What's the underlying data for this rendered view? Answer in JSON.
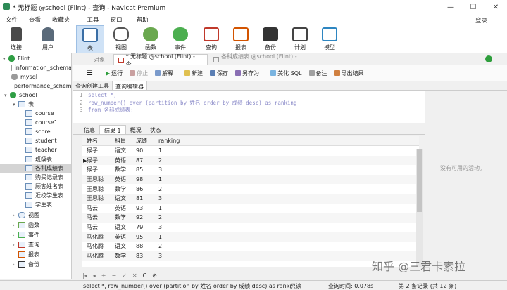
{
  "window": {
    "title": "* 无标题 @school (Flint) - 查询 - Navicat Premium",
    "min": "—",
    "max": "☐",
    "close": "✕"
  },
  "menu": [
    "文件",
    "查看",
    "收藏夹",
    "工具",
    "窗口",
    "帮助"
  ],
  "login_label": "登录",
  "toolbar": {
    "connect": "连接",
    "user": "用户",
    "table": "表",
    "view": "视图",
    "function": "函数",
    "event": "事件",
    "query": "查询",
    "report": "报表",
    "backup": "备份",
    "schedule": "计划",
    "model": "模型"
  },
  "sidebar": {
    "items": [
      "Flint",
      "information_schema",
      "mysql",
      "performance_schema",
      "school",
      "表",
      "course",
      "course1",
      "score",
      "student",
      "teacher",
      "班级表",
      "各科成绩表",
      "购买记录表",
      "顾客姓名表",
      "近校学生表",
      "学生表",
      "视图",
      "函数",
      "事件",
      "查询",
      "报表",
      "备份"
    ]
  },
  "tabs": {
    "objects": "对象",
    "active": "* 无标题 @school (Flint) - 查...",
    "inactive": "各科成绩表 @school (Flint) - ..."
  },
  "query_toolbar": {
    "run": "运行",
    "stop": "停止",
    "explain": "解释",
    "new": "新建",
    "save": "保存",
    "save_as": "另存为",
    "beautify": "美化 SQL",
    "comment": "备注",
    "export": "导出结果"
  },
  "query_tabs": [
    "查询创建工具",
    "查询编辑器"
  ],
  "editor": {
    "line1": "select *,",
    "line2": "row_number() over (partition by 姓名 order by 成绩 desc) as ranking",
    "line3": "from 各科成绩表;"
  },
  "result_tabs": [
    "信息",
    "结果 1",
    "概况",
    "状态"
  ],
  "grid": {
    "columns": [
      "姓名",
      "科目",
      "成绩",
      "ranking"
    ],
    "rows": [
      [
        "猴子",
        "语文",
        "90",
        "1"
      ],
      [
        "猴子",
        "英语",
        "87",
        "2"
      ],
      [
        "猴子",
        "数学",
        "85",
        "3"
      ],
      [
        "王思聪",
        "英语",
        "98",
        "1"
      ],
      [
        "王思聪",
        "数学",
        "86",
        "2"
      ],
      [
        "王思聪",
        "语文",
        "81",
        "3"
      ],
      [
        "马云",
        "英语",
        "93",
        "1"
      ],
      [
        "马云",
        "数学",
        "92",
        "2"
      ],
      [
        "马云",
        "语文",
        "79",
        "3"
      ],
      [
        "马化腾",
        "英语",
        "95",
        "1"
      ],
      [
        "马化腾",
        "语文",
        "88",
        "2"
      ],
      [
        "马化腾",
        "数学",
        "83",
        "3"
      ]
    ]
  },
  "right_panel": {
    "no_info": "没有可用的活动。"
  },
  "grid_nav": [
    "|◂",
    "◂",
    "+",
    "−",
    "✓",
    "✕",
    "C",
    "⊘"
  ],
  "status": {
    "sql": "select *, row_number() over (partition by 姓名 order by 成绩 desc) as rankir",
    "readonly": "只读",
    "time": "查询时间: 0.078s",
    "record": "第 2 条记录 (共 12 条)"
  },
  "watermark": "知乎 @三君卡索拉",
  "colors": {
    "accent": "#cfe2f6",
    "run": "#2e9e3c"
  }
}
